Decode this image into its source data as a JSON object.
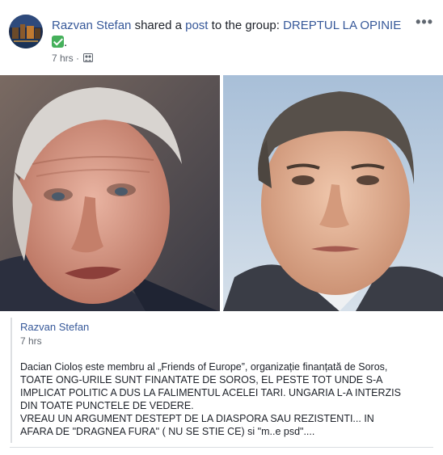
{
  "header": {
    "author": "Razvan Stefan",
    "action_before": " shared a ",
    "post_link": "post",
    "action_after": " to the group: ",
    "group": "DREPTUL LA OPINIE",
    "group_suffix": ".",
    "timestamp": "7 hrs",
    "separator": " · ",
    "audience_icon": "group-members-icon",
    "more_label": "•••"
  },
  "shared_post": {
    "author": "Razvan Stefan",
    "timestamp": "7 hrs",
    "lines": [
      "Dacian Cioloș este membru al „Friends of Europe”, organizație finanțată de Soros,",
      "TOATE ONG-URILE SUNT FINANTATE DE SOROS, EL PESTE TOT UNDE S-A",
      "IMPLICAT POLITIC A DUS LA FALIMENTUL ACELEI TARI. UNGARIA L-A INTERZIS",
      "DIN TOATE PUNCTELE DE VEDERE.",
      "VREAU UN ARGUMENT DESTEPT DE LA DIASPORA SAU REZISTENTI... IN",
      "AFARA DE \"DRAGNEA FURA\" ( NU SE STIE CE) si \"m..e psd\"...."
    ]
  },
  "colors": {
    "link": "#365899",
    "text": "#1d2129",
    "muted": "#606770",
    "check": "#45b05b"
  }
}
